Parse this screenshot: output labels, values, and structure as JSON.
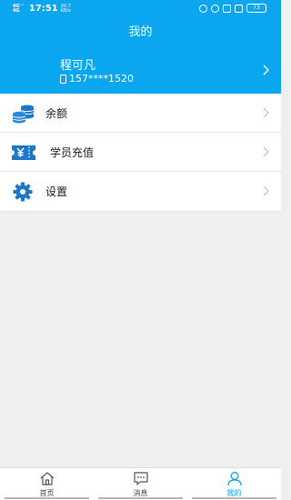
{
  "status_bar": {
    "signal_top": "4G⁺⁺",
    "signal_bottom": "4G",
    "time": "17:51",
    "speed_value": "20.7",
    "speed_unit": "KB/s",
    "battery": "73"
  },
  "header": {
    "title": "我的"
  },
  "profile": {
    "name": "程可凡",
    "phone": "157****1520"
  },
  "menu": [
    {
      "label": "余额",
      "icon": "coins-stack-icon"
    },
    {
      "label": "学员充值",
      "icon": "yuan-ticket-icon"
    },
    {
      "label": "设置",
      "icon": "gear-icon"
    }
  ],
  "tabbar": [
    {
      "label": "首页",
      "icon": "home-icon",
      "active": false
    },
    {
      "label": "消息",
      "icon": "message-icon",
      "active": false
    },
    {
      "label": "我的",
      "icon": "person-icon",
      "active": true
    }
  ],
  "colors": {
    "primary": "#0aa6ef",
    "background": "#efefef",
    "icon_blue": "#1d78c8"
  }
}
